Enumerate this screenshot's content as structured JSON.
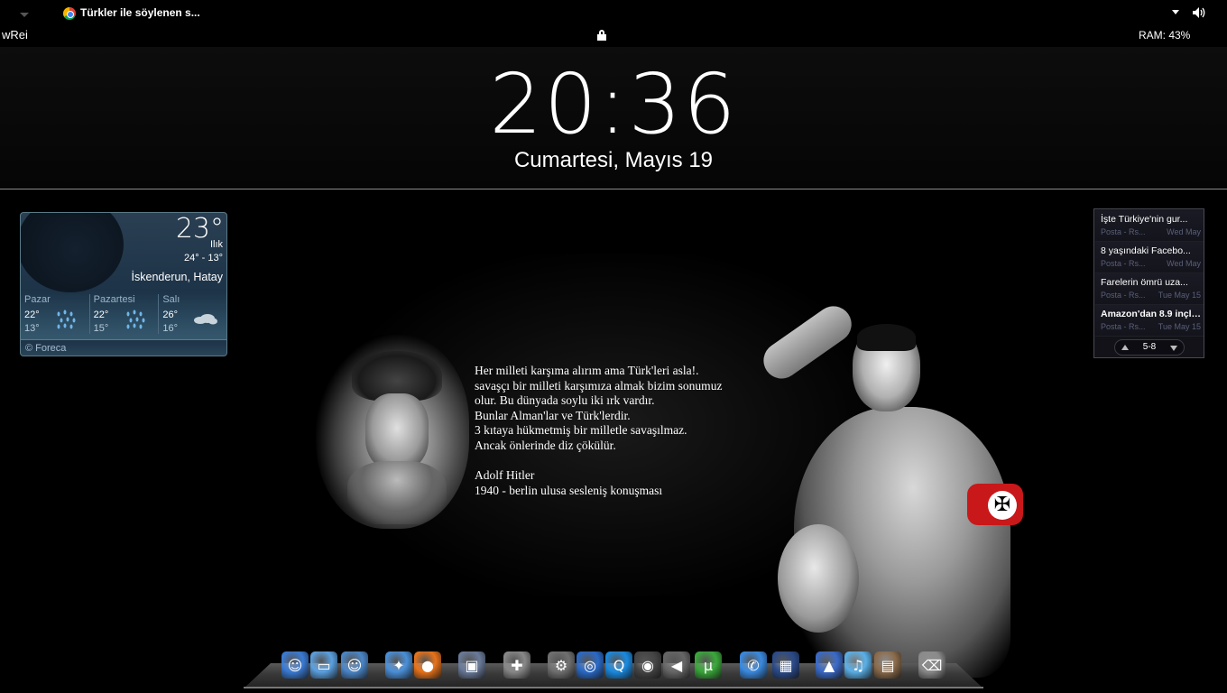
{
  "topbar": {
    "tab_title": "Türkler ile söylenen s...",
    "user": "wRei",
    "ram": "RAM: 43%"
  },
  "clock": {
    "time": "20:36",
    "date": "Cumartesi, Mayıs 19"
  },
  "wallpaper": {
    "quote_lines": [
      "Her milleti karşıma alırım ama Türk'leri asla!.",
      "savaşçı bir milleti karşımıza almak bizim sonumuz",
      "olur. Bu dünyada soylu iki ırk vardır.",
      "Bunlar Alman'lar ve Türk'lerdir.",
      "3 kıtaya hükmetmiş bir milletle savaşılmaz.",
      "Ancak önlerinde diz çökülür."
    ],
    "attribution": "Adolf Hitler",
    "attribution_detail": "1940 - berlin ulusa sesleniş konuşması"
  },
  "weather": {
    "temp": "23°",
    "condition": "Ilık",
    "range": "24°  -  13°",
    "location": "İskenderun, Hatay",
    "days": [
      {
        "name": "Pazar",
        "hi": "22°",
        "lo": "13°",
        "icon": "rain-icon"
      },
      {
        "name": "Pazartesi",
        "hi": "22°",
        "lo": "15°",
        "icon": "rain-icon"
      },
      {
        "name": "Salı",
        "hi": "26°",
        "lo": "16°",
        "icon": "cloud-icon"
      }
    ],
    "credit": "© Foreca"
  },
  "news": {
    "items": [
      {
        "headline": "İşte Türkiye'nin gur...",
        "source": "Posta - Rs...",
        "date": "Wed May",
        "bold": false
      },
      {
        "headline": "8 yaşındaki Facebo...",
        "source": "Posta - Rs...",
        "date": "Wed May",
        "bold": false
      },
      {
        "headline": "Farelerin ömrü uza...",
        "source": "Posta - Rs...",
        "date": "Tue May 15",
        "bold": false
      },
      {
        "headline": "Amazon'dan 8.9 inçli...",
        "source": "Posta - Rs...",
        "date": "Tue May 15",
        "bold": true
      }
    ],
    "page": "5-8"
  },
  "dock": {
    "icons": [
      {
        "name": "finder-icon",
        "glyph": "☺",
        "color": "#3a7bd5"
      },
      {
        "name": "monitor-icon",
        "glyph": "▭",
        "color": "#5aa0e0"
      },
      {
        "name": "finder-alt-icon",
        "glyph": "☺",
        "color": "#4a86c8"
      },
      {
        "name": "safari-icon",
        "glyph": "✦",
        "color": "#4a8fd8"
      },
      {
        "name": "firefox-icon",
        "glyph": "●",
        "color": "#e8731a"
      },
      {
        "name": "photo-viewer-icon",
        "glyph": "▣",
        "color": "#6a7a9a"
      },
      {
        "name": "gamepad-icon",
        "glyph": "✚",
        "color": "#888888"
      },
      {
        "name": "system-prefs-icon",
        "glyph": "⚙",
        "color": "#707070"
      },
      {
        "name": "media-player-icon",
        "glyph": "◎",
        "color": "#2a6ac8"
      },
      {
        "name": "quicktime-icon",
        "glyph": "Q",
        "color": "#1a8ae0"
      },
      {
        "name": "dashboard-icon",
        "glyph": "◉",
        "color": "#444444"
      },
      {
        "name": "back-icon",
        "glyph": "◀",
        "color": "#666666"
      },
      {
        "name": "utorrent-icon",
        "glyph": "µ",
        "color": "#3aa83a"
      },
      {
        "name": "ichat-icon",
        "glyph": "✆",
        "color": "#3a8ae0"
      },
      {
        "name": "clapper-icon",
        "glyph": "▦",
        "color": "#2a4a8a"
      },
      {
        "name": "rocket-icon",
        "glyph": "▲",
        "color": "#3a6ac8"
      },
      {
        "name": "itunes-icon",
        "glyph": "♫",
        "color": "#5ab0e8"
      },
      {
        "name": "photos-icon",
        "glyph": "▤",
        "color": "#8a6a4a"
      },
      {
        "name": "trash-icon",
        "glyph": "⌫",
        "color": "#8a8a8a"
      }
    ]
  }
}
